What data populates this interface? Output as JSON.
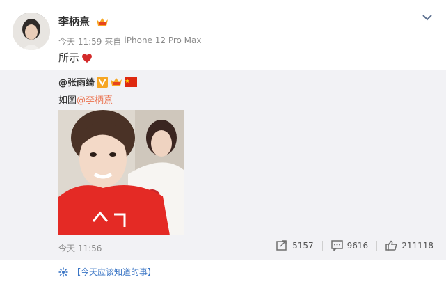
{
  "post": {
    "author": "李柄熹",
    "time": "今天 11:59",
    "source_prefix": "来自",
    "source": "iPhone 12 Pro Max",
    "text": "所示"
  },
  "repost": {
    "author": "@张雨绮",
    "text_prefix": "如图",
    "mention": "@李柄熹",
    "time": "今天 11:56",
    "stats": {
      "reposts": "5157",
      "comments": "9616",
      "likes": "211118"
    }
  },
  "topic": {
    "text": "【今天应该知道的事】"
  },
  "icons": {
    "vip": "vip-crown-icon",
    "verified": "verified-v-icon",
    "flag": "china-flag-icon",
    "heart": "heart-icon",
    "chevron": "chevron-down-icon",
    "repost": "repost-icon",
    "comment": "comment-icon",
    "like": "like-icon",
    "topic": "topic-icon"
  },
  "colors": {
    "mention": "#eb7350",
    "topic": "#3a75c5",
    "repost_bg": "#f2f2f5",
    "heart": "#d32a2a"
  }
}
